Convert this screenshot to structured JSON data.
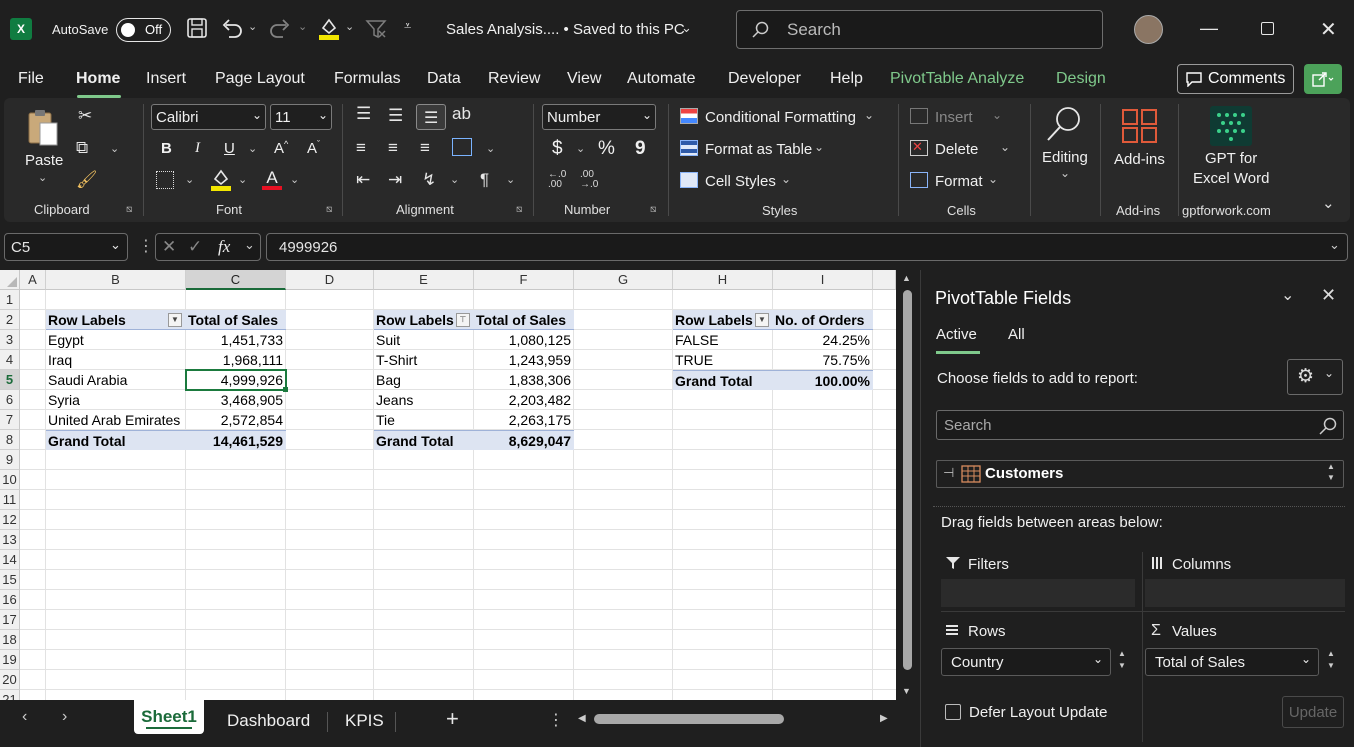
{
  "titlebar": {
    "app_icon": "X",
    "autosave_label": "AutoSave",
    "autosave_state": "Off",
    "doc_title": "Sales Analysis.... • Saved to this PC",
    "search_placeholder": "Search"
  },
  "menu": {
    "tabs": [
      "File",
      "Home",
      "Insert",
      "Page Layout",
      "Formulas",
      "Data",
      "Review",
      "View",
      "Automate",
      "Developer",
      "Help",
      "PivotTable Analyze",
      "Design"
    ],
    "comments_label": "Comments"
  },
  "ribbon": {
    "clipboard": {
      "paste": "Paste",
      "label": "Clipboard"
    },
    "font": {
      "family": "Calibri",
      "size": "11",
      "label": "Font",
      "bold": "B",
      "italic": "I",
      "underline": "U"
    },
    "alignment": {
      "label": "Alignment"
    },
    "number": {
      "format": "Number",
      "label": "Number",
      "currency": "$",
      "percent": "%",
      "comma": "9"
    },
    "styles": {
      "conditional": "Conditional Formatting",
      "table": "Format as Table",
      "cell": "Cell Styles",
      "label": "Styles"
    },
    "cells": {
      "insert": "Insert",
      "delete": "Delete",
      "format": "Format",
      "label": "Cells"
    },
    "editing": {
      "label": "Editing"
    },
    "addins": {
      "button": "Add-ins",
      "label": "Add-ins"
    },
    "gpt": {
      "line1": "GPT for",
      "line2": "Excel Word",
      "label": "gptforwork.com"
    }
  },
  "formula_bar": {
    "name_box": "C5",
    "value": "4999926",
    "fx": "fx"
  },
  "grid": {
    "columns": [
      "A",
      "B",
      "C",
      "D",
      "E",
      "F",
      "G",
      "H",
      "I"
    ],
    "rows": [
      "1",
      "2",
      "3",
      "4",
      "5",
      "6",
      "7",
      "8",
      "9",
      "10",
      "11",
      "12",
      "13",
      "14",
      "15",
      "16",
      "17",
      "18",
      "19",
      "20",
      "21"
    ],
    "pivot1": {
      "header": [
        "Row Labels",
        "Total of Sales"
      ],
      "rows": [
        [
          "Egypt",
          "1,451,733"
        ],
        [
          "Iraq",
          "1,968,111"
        ],
        [
          "Saudi Arabia",
          "4,999,926"
        ],
        [
          "Syria",
          "3,468,905"
        ],
        [
          "United Arab Emirates",
          "2,572,854"
        ]
      ],
      "total": [
        "Grand Total",
        "14,461,529"
      ]
    },
    "pivot2": {
      "header": [
        "Row Labels",
        "Total of Sales"
      ],
      "rows": [
        [
          "Suit",
          "1,080,125"
        ],
        [
          "T-Shirt",
          "1,243,959"
        ],
        [
          "Bag",
          "1,838,306"
        ],
        [
          "Jeans",
          "2,203,482"
        ],
        [
          "Tie",
          "2,263,175"
        ]
      ],
      "total": [
        "Grand Total",
        "8,629,047"
      ]
    },
    "pivot3": {
      "header": [
        "Row Labels",
        "No. of Orders"
      ],
      "rows": [
        [
          "FALSE",
          "24.25%"
        ],
        [
          "TRUE",
          "75.75%"
        ]
      ],
      "total": [
        "Grand Total",
        "100.00%"
      ]
    }
  },
  "sheets": {
    "tabs": [
      "Sheet1",
      "Dashboard",
      "KPIS"
    ],
    "active": "Sheet1",
    "add": "+"
  },
  "pivot_pane": {
    "title": "PivotTable Fields",
    "tab_active": "Active",
    "tab_all": "All",
    "choose_text": "Choose fields to add to report:",
    "search_placeholder": "Search",
    "table_name": "Customers",
    "drag_text": "Drag fields between areas below:",
    "filters": "Filters",
    "columns": "Columns",
    "rows": "Rows",
    "values": "Values",
    "rows_field": "Country",
    "values_field": "Total of Sales",
    "defer": "Defer Layout Update",
    "update": "Update"
  },
  "colors": {
    "accent": "#7fc98b",
    "excel_green": "#107c41",
    "pivot_header": "#dde4f2"
  }
}
